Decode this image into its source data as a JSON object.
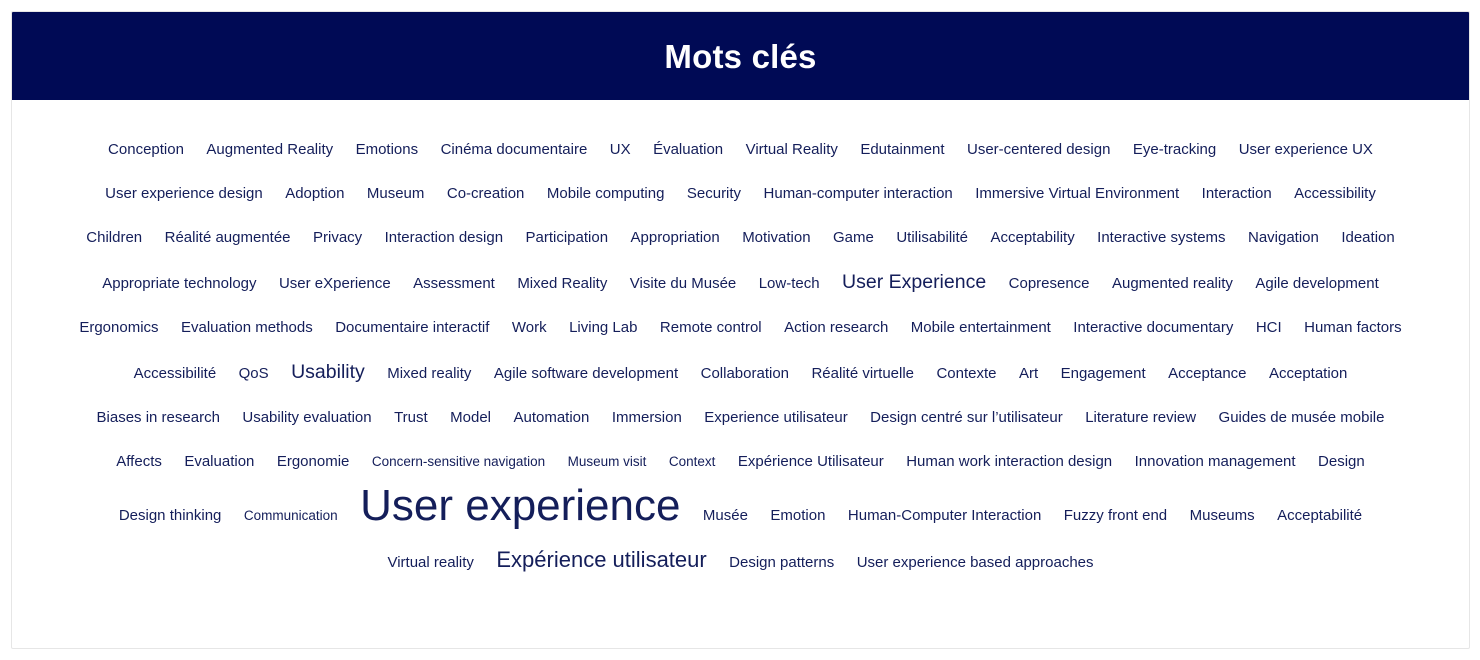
{
  "header": {
    "title": "Mots clés",
    "background_color": "#000a55",
    "text_color": "#ffffff"
  },
  "cloud": {
    "text_color": "#141e5a",
    "tags": [
      {
        "label": "Conception",
        "size": 2
      },
      {
        "label": "Augmented Reality",
        "size": 2
      },
      {
        "label": "Emotions",
        "size": 2
      },
      {
        "label": "Cinéma documentaire",
        "size": 2
      },
      {
        "label": "UX",
        "size": 2
      },
      {
        "label": "Évaluation",
        "size": 2
      },
      {
        "label": "Virtual Reality",
        "size": 2
      },
      {
        "label": "Edutainment",
        "size": 2
      },
      {
        "label": "User-centered design",
        "size": 2
      },
      {
        "label": "Eye-tracking",
        "size": 2
      },
      {
        "label": "User experience UX",
        "size": 2
      },
      {
        "label": "User experience design",
        "size": 2
      },
      {
        "label": "Adoption",
        "size": 2
      },
      {
        "label": "Museum",
        "size": 2
      },
      {
        "label": "Co-creation",
        "size": 2
      },
      {
        "label": "Mobile computing",
        "size": 2
      },
      {
        "label": "Security",
        "size": 2
      },
      {
        "label": "Human-computer interaction",
        "size": 2
      },
      {
        "label": "Immersive Virtual Environment",
        "size": 2
      },
      {
        "label": "Interaction",
        "size": 2
      },
      {
        "label": "Accessibility",
        "size": 2
      },
      {
        "label": "Children",
        "size": 2
      },
      {
        "label": "Réalité augmentée",
        "size": 2
      },
      {
        "label": "Privacy",
        "size": 2
      },
      {
        "label": "Interaction design",
        "size": 2
      },
      {
        "label": "Participation",
        "size": 2
      },
      {
        "label": "Appropriation",
        "size": 2
      },
      {
        "label": "Motivation",
        "size": 2
      },
      {
        "label": "Game",
        "size": 2
      },
      {
        "label": "Utilisabilité",
        "size": 2
      },
      {
        "label": "Acceptability",
        "size": 2
      },
      {
        "label": "Interactive systems",
        "size": 2
      },
      {
        "label": "Navigation",
        "size": 2
      },
      {
        "label": "Ideation",
        "size": 2
      },
      {
        "label": "Appropriate technology",
        "size": 2
      },
      {
        "label": "User eXperience",
        "size": 2
      },
      {
        "label": "Assessment",
        "size": 2
      },
      {
        "label": "Mixed Reality",
        "size": 2
      },
      {
        "label": "Visite du Musée",
        "size": 2
      },
      {
        "label": "Low-tech",
        "size": 2
      },
      {
        "label": "User Experience",
        "size": 4
      },
      {
        "label": "Copresence",
        "size": 2
      },
      {
        "label": "Augmented reality",
        "size": 2
      },
      {
        "label": "Agile development",
        "size": 2
      },
      {
        "label": "Ergonomics",
        "size": 2
      },
      {
        "label": "Evaluation methods",
        "size": 2
      },
      {
        "label": "Documentaire interactif",
        "size": 2
      },
      {
        "label": "Work",
        "size": 2
      },
      {
        "label": "Living Lab",
        "size": 2
      },
      {
        "label": "Remote control",
        "size": 2
      },
      {
        "label": "Action research",
        "size": 2
      },
      {
        "label": "Mobile entertainment",
        "size": 2
      },
      {
        "label": "Interactive documentary",
        "size": 2
      },
      {
        "label": "HCI",
        "size": 2
      },
      {
        "label": "Human factors",
        "size": 2
      },
      {
        "label": "Accessibilité",
        "size": 2
      },
      {
        "label": "QoS",
        "size": 2
      },
      {
        "label": "Usability",
        "size": 4
      },
      {
        "label": "Mixed reality",
        "size": 2
      },
      {
        "label": "Agile software development",
        "size": 2
      },
      {
        "label": "Collaboration",
        "size": 2
      },
      {
        "label": "Réalité virtuelle",
        "size": 2
      },
      {
        "label": "Contexte",
        "size": 2
      },
      {
        "label": "Art",
        "size": 2
      },
      {
        "label": "Engagement",
        "size": 2
      },
      {
        "label": "Acceptance",
        "size": 2
      },
      {
        "label": "Acceptation",
        "size": 2
      },
      {
        "label": "Biases in research",
        "size": 2
      },
      {
        "label": "Usability evaluation",
        "size": 2
      },
      {
        "label": "Trust",
        "size": 2
      },
      {
        "label": "Model",
        "size": 2
      },
      {
        "label": "Automation",
        "size": 2
      },
      {
        "label": "Immersion",
        "size": 2
      },
      {
        "label": "Experience utilisateur",
        "size": 2
      },
      {
        "label": "Design centré sur l’utilisateur",
        "size": 2
      },
      {
        "label": "Literature review",
        "size": 2
      },
      {
        "label": "Guides de musée mobile",
        "size": 2
      },
      {
        "label": "Affects",
        "size": 2
      },
      {
        "label": "Evaluation",
        "size": 2
      },
      {
        "label": "Ergonomie",
        "size": 2
      },
      {
        "label": "Concern-sensitive navigation",
        "size": 1
      },
      {
        "label": "Museum visit",
        "size": 1
      },
      {
        "label": "Context",
        "size": 1
      },
      {
        "label": "Expérience Utilisateur",
        "size": 2
      },
      {
        "label": "Human work interaction design",
        "size": 2
      },
      {
        "label": "Innovation management",
        "size": 2
      },
      {
        "label": "Design",
        "size": 2
      },
      {
        "label": "Design thinking",
        "size": 2
      },
      {
        "label": "Communication",
        "size": 1
      },
      {
        "label": "User experience",
        "size": 7
      },
      {
        "label": "Musée",
        "size": 2
      },
      {
        "label": "Emotion",
        "size": 2
      },
      {
        "label": "Human-Computer Interaction",
        "size": 2
      },
      {
        "label": "Fuzzy front end",
        "size": 2
      },
      {
        "label": "Museums",
        "size": 2
      },
      {
        "label": "Acceptabilité",
        "size": 2
      },
      {
        "label": "Virtual reality",
        "size": 2
      },
      {
        "label": "Expérience utilisateur",
        "size": 5
      },
      {
        "label": "Design patterns",
        "size": 2
      },
      {
        "label": "User experience based approaches",
        "size": 2
      }
    ]
  }
}
